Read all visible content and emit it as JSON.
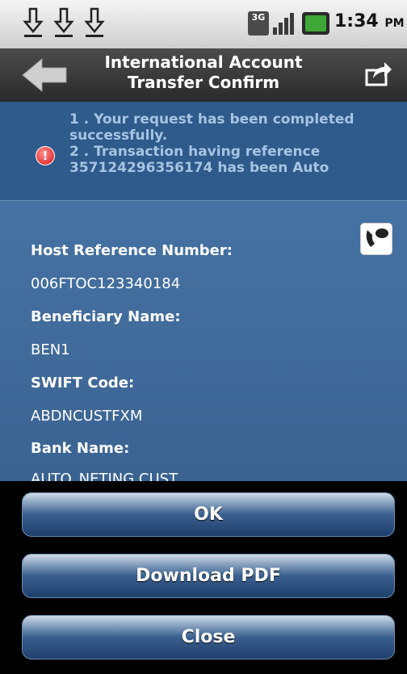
{
  "statusbar": {
    "network": "3G",
    "time": "1:34",
    "ampm": "PM"
  },
  "header": {
    "title_line1": "International Account",
    "title_line2": "Transfer Confirm"
  },
  "message": {
    "line1": "1 . Your request has been completed",
    "line2": "successfully.",
    "line3": "2 . Transaction having reference",
    "line4": "357124296356174 has been Auto"
  },
  "details": {
    "host_ref_label": "Host Reference Number:",
    "host_ref_value": "006FTOC123340184",
    "beneficiary_label": "Beneficiary Name:",
    "beneficiary_value": "BEN1",
    "swift_label": "SWIFT Code:",
    "swift_value": "ABDNCUSTFXM",
    "bank_label": "Bank Name:",
    "bank_value": "AUTO_NETING CUST"
  },
  "buttons": {
    "ok": "OK",
    "download": "Download PDF",
    "close": "Close"
  },
  "colors": {
    "content_bg": "#4a78aa",
    "button": "#2b4f80",
    "alert": "#d41717"
  }
}
